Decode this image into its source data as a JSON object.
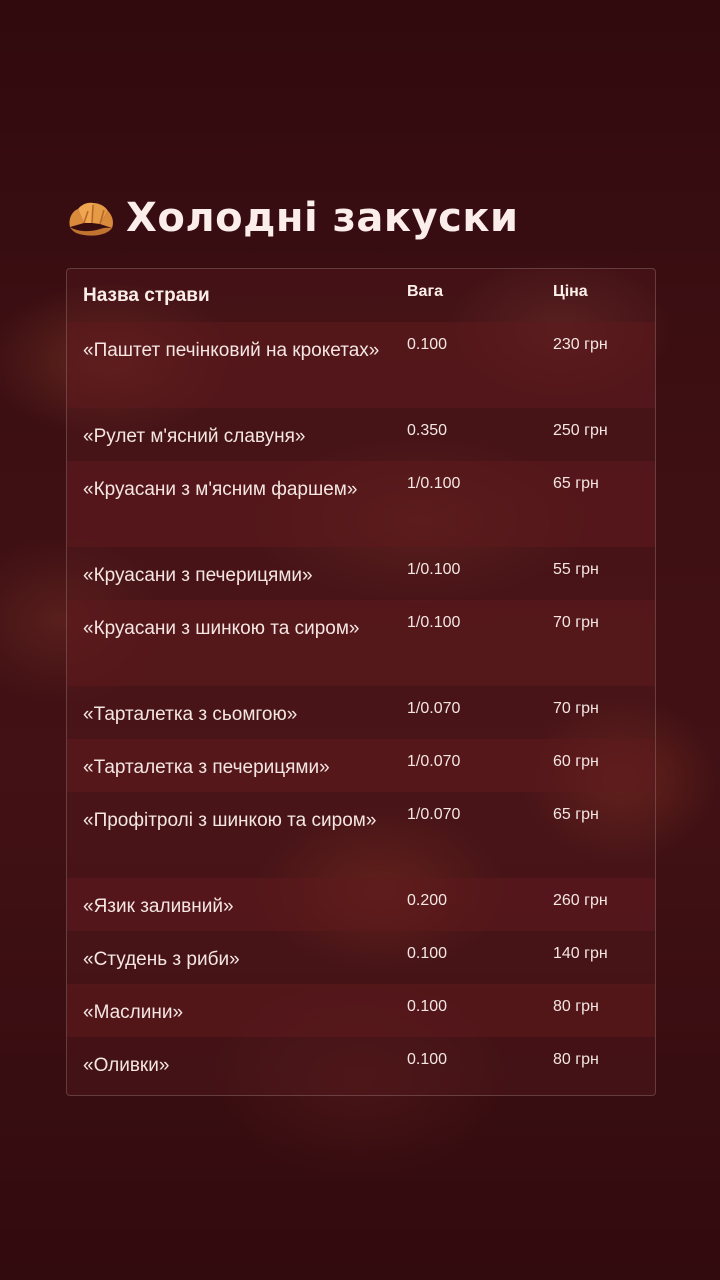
{
  "header": {
    "icon": "croissant-icon",
    "title": "Холодні закуски"
  },
  "table": {
    "columns": {
      "name": "Назва страви",
      "weight": "Вага",
      "price": "Ціна"
    },
    "rows": [
      {
        "name": "«Паштет печінковий на крокетах»",
        "weight": "0.100",
        "price": "230 грн"
      },
      {
        "name": "«Рулет м'ясний славуня»",
        "weight": "0.350",
        "price": "250 грн"
      },
      {
        "name": "«Круасани з м'ясним фаршем»",
        "weight": "1/0.100",
        "price": "65 грн"
      },
      {
        "name": "«Круасани з печерицями»",
        "weight": "1/0.100",
        "price": "55 грн"
      },
      {
        "name": "«Круасани з шинкою та сиром»",
        "weight": "1/0.100",
        "price": "70 грн"
      },
      {
        "name": "«Тарталетка з сьомгою»",
        "weight": "1/0.070",
        "price": "70 грн"
      },
      {
        "name": "«Тарталетка з печерицями»",
        "weight": "1/0.070",
        "price": "60 грн"
      },
      {
        "name": "«Профітролі з шинкою та сиром»",
        "weight": "1/0.070",
        "price": "65 грн"
      },
      {
        "name": "«Язик заливний»",
        "weight": "0.200",
        "price": "260 грн"
      },
      {
        "name": "«Студень з риби»",
        "weight": "0.100",
        "price": "140 грн"
      },
      {
        "name": "«Маслини»",
        "weight": "0.100",
        "price": "80 грн"
      },
      {
        "name": "«Оливки»",
        "weight": "0.100",
        "price": "80 грн"
      }
    ]
  },
  "colors": {
    "background": "#3a0f12",
    "text": "#f4e6e2",
    "accent": "#e9a04a"
  }
}
